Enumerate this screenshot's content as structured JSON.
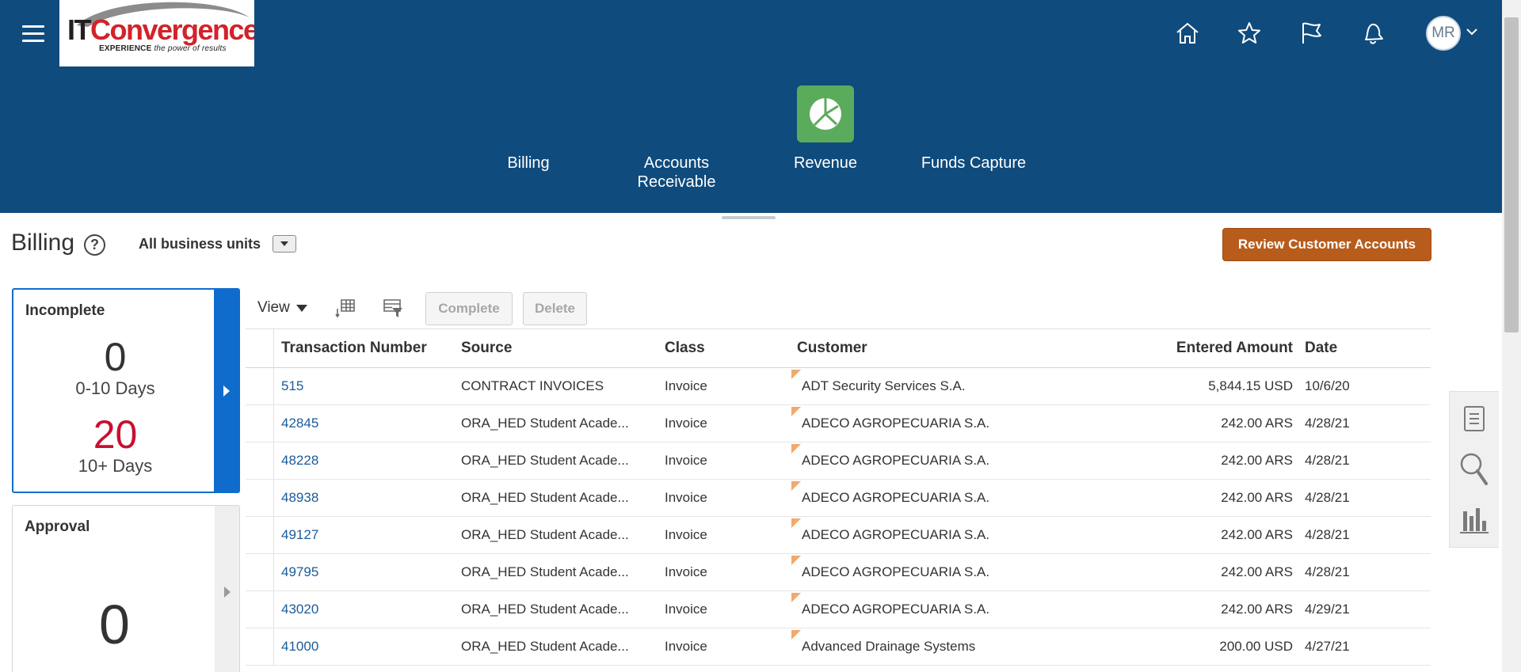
{
  "header": {
    "logo": {
      "brand_prefix": "IT",
      "brand_name": "Convergence",
      "tagline_bold": "EXPERIENCE",
      "tagline_rest": " the power of results"
    },
    "icons": [
      "home-icon",
      "favorites-star-icon",
      "watchlist-flag-icon",
      "notifications-bell-icon"
    ],
    "avatar_initials": "MR",
    "nav_tabs": [
      {
        "label": "Billing"
      },
      {
        "label": "Accounts Receivable",
        "line1": "Accounts",
        "line2": "Receivable"
      },
      {
        "label": "Revenue",
        "icon": "revenue-pie-icon",
        "icon_color": "#5bab5d"
      },
      {
        "label": "Funds Capture"
      }
    ],
    "colors": {
      "background": "#0f4b7d"
    }
  },
  "page": {
    "title": "Billing",
    "business_unit": "All business units",
    "review_button": "Review Customer Accounts",
    "review_button_color": "#b85c1b"
  },
  "panels": {
    "incomplete": {
      "title": "Incomplete",
      "count_recent": "0",
      "label_recent": "0-10 Days",
      "count_old": "20",
      "label_old": "10+ Days",
      "accent_color": "#0f6ccc",
      "alert_color": "#c8102e"
    },
    "approval": {
      "title": "Approval",
      "count": "0"
    }
  },
  "toolbar": {
    "view_label": "View",
    "complete_label": "Complete",
    "delete_label": "Delete"
  },
  "table": {
    "columns": [
      "Transaction Number",
      "Source",
      "Class",
      "Customer",
      "Entered Amount",
      "Date"
    ],
    "rows": [
      {
        "number": "515",
        "source": "CONTRACT INVOICES",
        "class": "Invoice",
        "customer": "ADT Security Services S.A.",
        "amount": "5,844.15 USD",
        "date": "10/6/20"
      },
      {
        "number": "42845",
        "source": "ORA_HED Student Acade...",
        "class": "Invoice",
        "customer": "ADECO AGROPECUARIA S.A.",
        "amount": "242.00 ARS",
        "date": "4/28/21"
      },
      {
        "number": "48228",
        "source": "ORA_HED Student Acade...",
        "class": "Invoice",
        "customer": "ADECO AGROPECUARIA S.A.",
        "amount": "242.00 ARS",
        "date": "4/28/21"
      },
      {
        "number": "48938",
        "source": "ORA_HED Student Acade...",
        "class": "Invoice",
        "customer": "ADECO AGROPECUARIA S.A.",
        "amount": "242.00 ARS",
        "date": "4/28/21"
      },
      {
        "number": "49127",
        "source": "ORA_HED Student Acade...",
        "class": "Invoice",
        "customer": "ADECO AGROPECUARIA S.A.",
        "amount": "242.00 ARS",
        "date": "4/28/21"
      },
      {
        "number": "49795",
        "source": "ORA_HED Student Acade...",
        "class": "Invoice",
        "customer": "ADECO AGROPECUARIA S.A.",
        "amount": "242.00 ARS",
        "date": "4/28/21"
      },
      {
        "number": "43020",
        "source": "ORA_HED Student Acade...",
        "class": "Invoice",
        "customer": "ADECO AGROPECUARIA S.A.",
        "amount": "242.00 ARS",
        "date": "4/29/21"
      },
      {
        "number": "41000",
        "source": "ORA_HED Student Acade...",
        "class": "Invoice",
        "customer": "Advanced Drainage Systems",
        "amount": "200.00 USD",
        "date": "4/27/21"
      }
    ]
  },
  "side_rail": {
    "icons": [
      "document-list-icon",
      "search-magnifier-icon",
      "bar-chart-icon"
    ]
  }
}
